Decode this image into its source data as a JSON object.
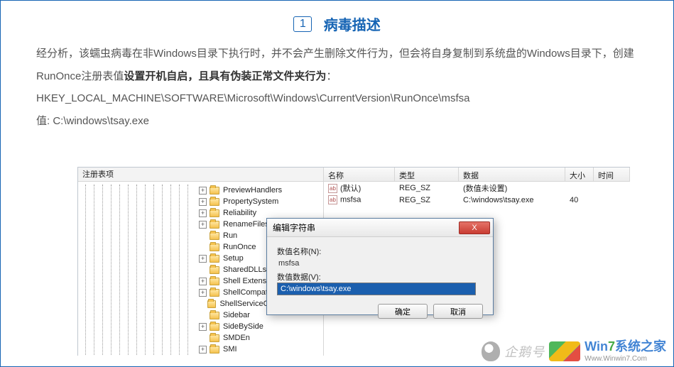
{
  "header": {
    "number": "1",
    "title": "病毒描述"
  },
  "description": {
    "line1a": "经分析，该蠕虫病毒在非Windows目录下执行时，并不会产生删除文件行为，但会将自身复制到系统盘的Windows目录下，创建RunOnce注册表值",
    "line1b": "设置开机自启，且具有伪装正常文件夹行为",
    "line1c": "：",
    "regpath": "HKEY_LOCAL_MACHINE\\SOFTWARE\\Microsoft\\Windows\\CurrentVersion\\RunOnce\\msfsa",
    "value_line": "值: C:\\windows\\tsay.exe"
  },
  "registry": {
    "tree_header": "注册表项",
    "nodes": [
      {
        "exp": "+",
        "label": "PreviewHandlers"
      },
      {
        "exp": "+",
        "label": "PropertySystem"
      },
      {
        "exp": "+",
        "label": "Reliability"
      },
      {
        "exp": "+",
        "label": "RenameFiles"
      },
      {
        "exp": "",
        "label": "Run"
      },
      {
        "exp": "",
        "label": "RunOnce"
      },
      {
        "exp": "+",
        "label": "Setup"
      },
      {
        "exp": "",
        "label": "SharedDLLs"
      },
      {
        "exp": "+",
        "label": "Shell Extensions"
      },
      {
        "exp": "+",
        "label": "ShellCompatibility"
      },
      {
        "exp": "",
        "label": "ShellServiceObjectDelayLoad"
      },
      {
        "exp": "",
        "label": "Sidebar"
      },
      {
        "exp": "+",
        "label": "SideBySide"
      },
      {
        "exp": "",
        "label": "SMDEn"
      },
      {
        "exp": "+",
        "label": "SMI"
      }
    ],
    "columns": {
      "name": "名称",
      "type": "类型",
      "data": "数据",
      "size": "大小",
      "time": "时间"
    },
    "rows": [
      {
        "name": "(默认)",
        "type": "REG_SZ",
        "data": "(数值未设置)",
        "size": "",
        "time": ""
      },
      {
        "name": "msfsa",
        "type": "REG_SZ",
        "data": "C:\\windows\\tsay.exe",
        "size": "40",
        "time": ""
      }
    ]
  },
  "dialog": {
    "title": "编辑字符串",
    "close": "X",
    "name_label": "数值名称(N):",
    "name_value": "msfsa",
    "data_label": "数值数据(V):",
    "data_value": "C:\\windows\\tsay.exe",
    "ok": "确定",
    "cancel": "取消"
  },
  "watermark": {
    "qh": "企鹅号",
    "brand_a": "Win",
    "brand_b": "7",
    "brand_c": "系统之家",
    "brand_sub": "Www.Winwin7.Com"
  }
}
